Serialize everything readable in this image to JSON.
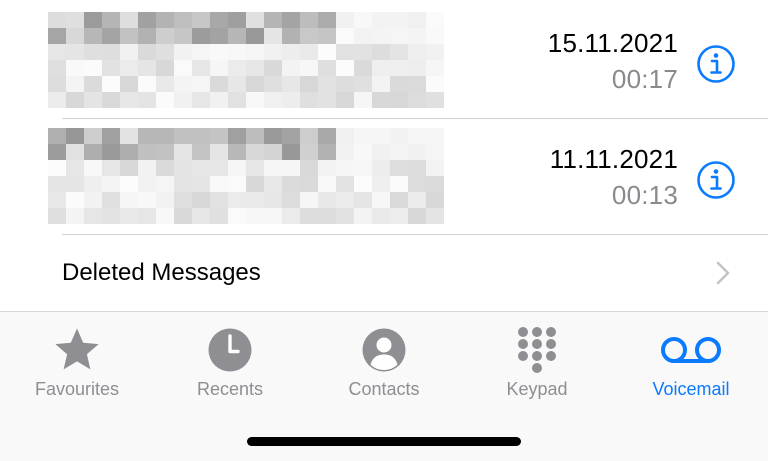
{
  "voicemails": [
    {
      "date": "15.11.2021",
      "duration": "00:17"
    },
    {
      "date": "11.11.2021",
      "duration": "00:13"
    }
  ],
  "deleted": {
    "label": "Deleted Messages"
  },
  "tabs": [
    {
      "label": "Favourites",
      "icon": "star-icon"
    },
    {
      "label": "Recents",
      "icon": "clock-icon"
    },
    {
      "label": "Contacts",
      "icon": "person-circle-icon"
    },
    {
      "label": "Keypad",
      "icon": "keypad-icon"
    },
    {
      "label": "Voicemail",
      "icon": "voicemail-icon"
    }
  ],
  "colors": {
    "accent": "#0a7aff",
    "secondary_text": "#8a8a8e",
    "tab_inactive": "#8e8e93",
    "separator": "#d1d1d6"
  }
}
